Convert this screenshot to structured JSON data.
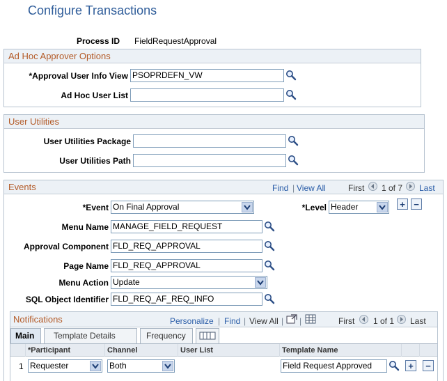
{
  "page": {
    "title": "Configure Transactions"
  },
  "process": {
    "label": "Process ID",
    "value": "FieldRequestApproval"
  },
  "adhoc": {
    "header": "Ad Hoc Approver Options",
    "approval_view_label": "*Approval User Info View",
    "approval_view_value": "PSOPRDEFN_VW",
    "user_list_label": "Ad Hoc User List",
    "user_list_value": ""
  },
  "utilities": {
    "header": "User Utilities",
    "package_label": "User Utilities Package",
    "package_value": "",
    "path_label": "User Utilities Path",
    "path_value": ""
  },
  "events": {
    "header": "Events",
    "find": "Find",
    "view_all": "View All",
    "sep": "|",
    "first": "First",
    "count": "1 of 7",
    "last": "Last",
    "event_label": "*Event",
    "event_value": "On Final Approval",
    "level_label": "*Level",
    "level_value": "Header",
    "add": "+",
    "remove": "−",
    "menu_name_label": "Menu Name",
    "menu_name_value": "MANAGE_FIELD_REQUEST",
    "component_label": "Approval Component",
    "component_value": "FLD_REQ_APPROVAL",
    "page_name_label": "Page Name",
    "page_name_value": "FLD_REQ_APPROVAL",
    "menu_action_label": "Menu Action",
    "menu_action_value": "Update",
    "sql_label": "SQL Object Identifier",
    "sql_value": "FLD_REQ_AF_REQ_INFO"
  },
  "notifications": {
    "header": "Notifications",
    "personalize": "Personalize",
    "find": "Find",
    "view_all": "View All",
    "sep": "|",
    "first": "First",
    "count": "1 of 1",
    "last": "Last",
    "tabs": [
      "Main",
      "Template Details",
      "Frequency"
    ],
    "columns": [
      "*Participant",
      "Channel",
      "User List",
      "Template Name"
    ],
    "rows": [
      {
        "num": "1",
        "participant": "Requester",
        "channel": "Both",
        "user_list": "",
        "template": "Field Request Approved"
      }
    ],
    "add": "+",
    "remove": "−"
  }
}
